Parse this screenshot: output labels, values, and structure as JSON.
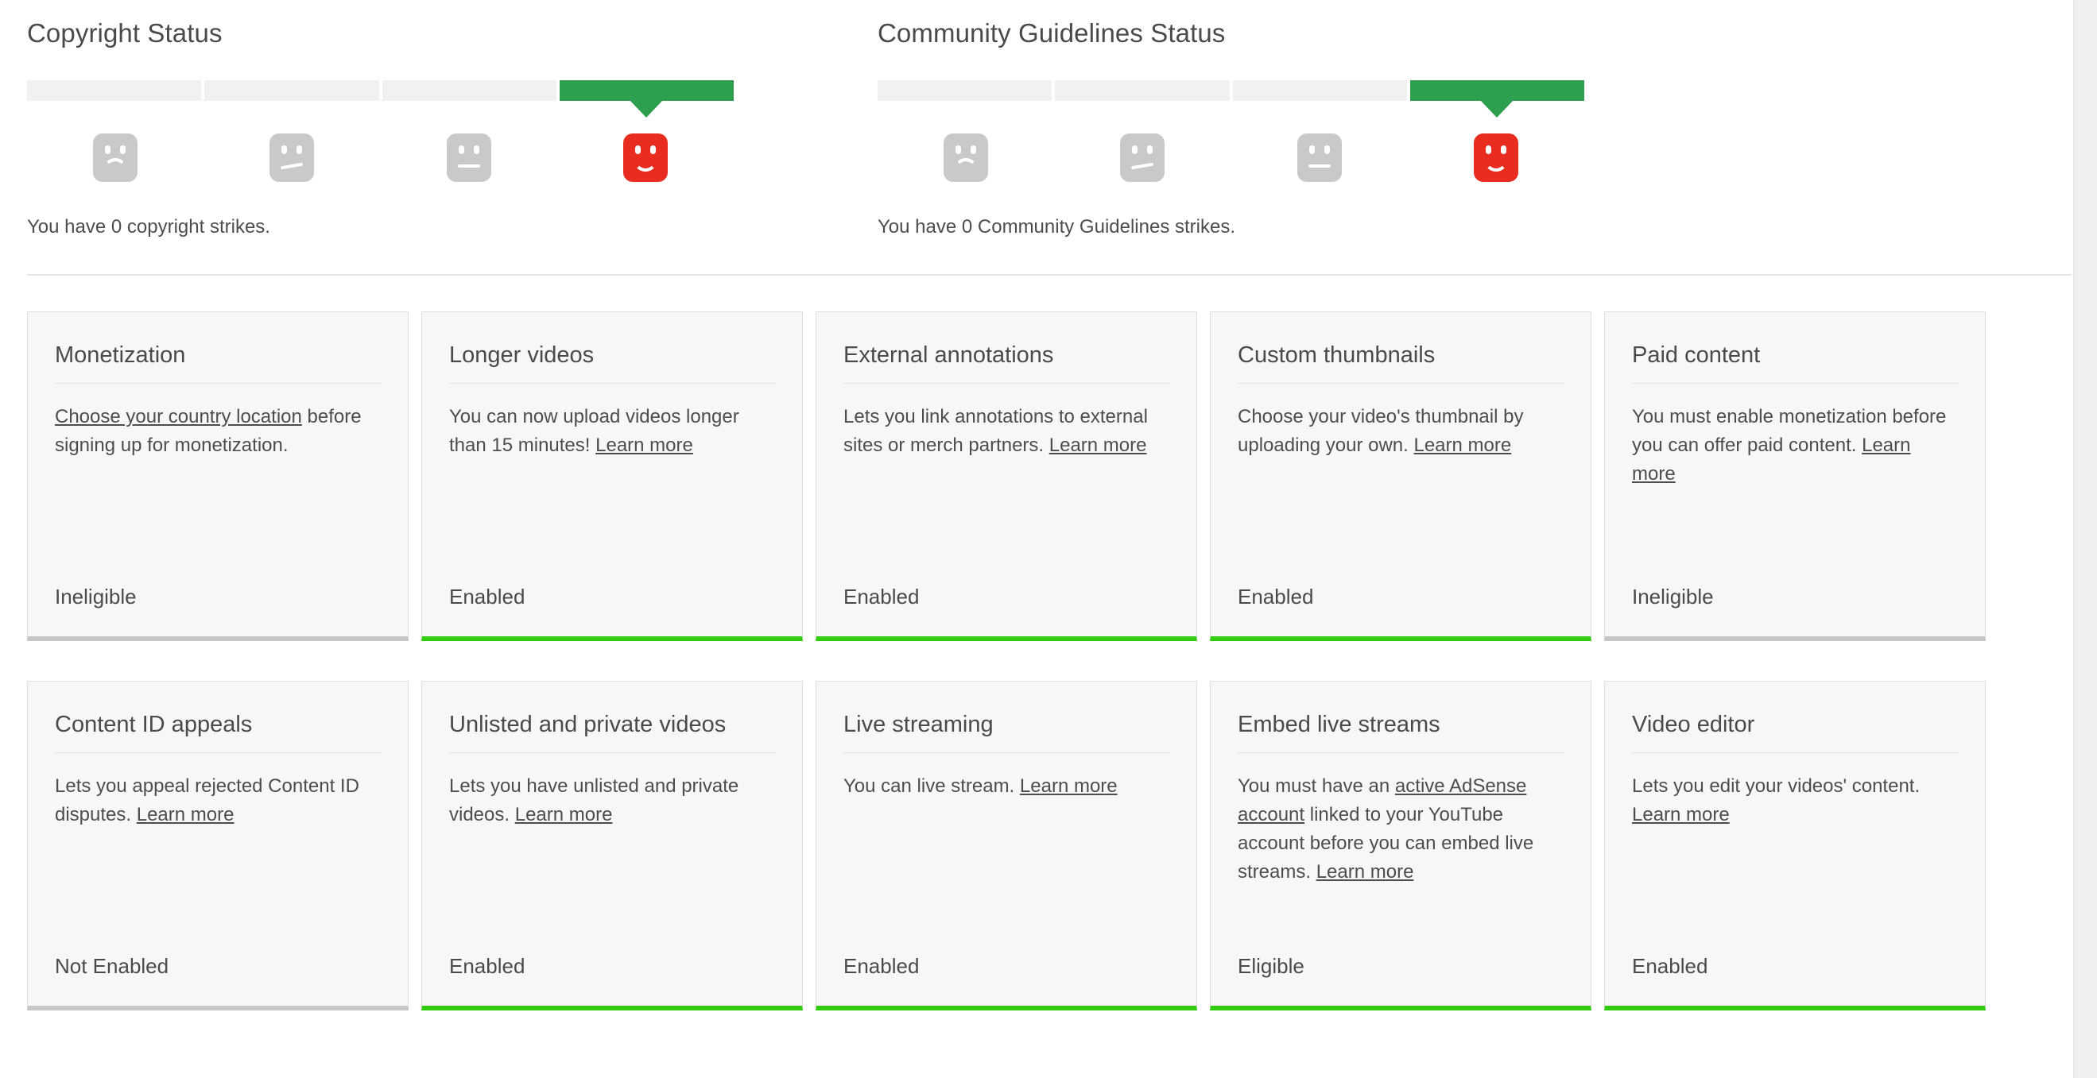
{
  "status_sections": [
    {
      "id": "copyright",
      "title": "Copyright Status",
      "caption": "You have 0 copyright strikes.",
      "segments": 4,
      "active_index": 3,
      "active_color": "#2e9e4f",
      "inactive_color": "#f1f1f1",
      "faces": [
        {
          "name": "sad-face-icon",
          "mood": "frown",
          "active": false
        },
        {
          "name": "slight-frown-icon",
          "mood": "slant",
          "active": false
        },
        {
          "name": "neutral-face-icon",
          "mood": "flat",
          "active": false
        },
        {
          "name": "happy-face-icon",
          "mood": "smile",
          "active": true
        }
      ]
    },
    {
      "id": "community",
      "title": "Community Guidelines Status",
      "caption": "You have 0 Community Guidelines strikes.",
      "segments": 4,
      "active_index": 3,
      "active_color": "#2e9e4f",
      "inactive_color": "#f1f1f1",
      "faces": [
        {
          "name": "sad-face-icon",
          "mood": "frown",
          "active": false
        },
        {
          "name": "slight-frown-icon",
          "mood": "slant",
          "active": false
        },
        {
          "name": "neutral-face-icon",
          "mood": "flat",
          "active": false
        },
        {
          "name": "happy-face-icon",
          "mood": "smile",
          "active": true
        }
      ]
    }
  ],
  "cards": [
    {
      "id": "monetization",
      "title": "Monetization",
      "body_parts": [
        {
          "text": "Choose your country location",
          "link": true
        },
        {
          "text": " before signing up for monetization.",
          "link": false
        }
      ],
      "status": "Ineligible",
      "enabled": false
    },
    {
      "id": "longer-videos",
      "title": "Longer videos",
      "body_parts": [
        {
          "text": "You can now upload videos longer than 15 minutes! ",
          "link": false
        },
        {
          "text": "Learn more",
          "link": true
        }
      ],
      "status": "Enabled",
      "enabled": true
    },
    {
      "id": "external-annotations",
      "title": "External annotations",
      "body_parts": [
        {
          "text": "Lets you link annotations to external sites or merch partners. ",
          "link": false
        },
        {
          "text": "Learn more",
          "link": true
        }
      ],
      "status": "Enabled",
      "enabled": true
    },
    {
      "id": "custom-thumbnails",
      "title": "Custom thumbnails",
      "body_parts": [
        {
          "text": "Choose your video's thumbnail by uploading your own. ",
          "link": false
        },
        {
          "text": "Learn more",
          "link": true
        }
      ],
      "status": "Enabled",
      "enabled": true
    },
    {
      "id": "paid-content",
      "title": "Paid content",
      "body_parts": [
        {
          "text": "You must enable monetization before you can offer paid content. ",
          "link": false
        },
        {
          "text": "Learn more",
          "link": true
        }
      ],
      "status": "Ineligible",
      "enabled": false
    },
    {
      "id": "content-id-appeals",
      "title": "Content ID appeals",
      "body_parts": [
        {
          "text": "Lets you appeal rejected Content ID disputes. ",
          "link": false
        },
        {
          "text": "Learn more",
          "link": true
        }
      ],
      "status": "Not Enabled",
      "enabled": false
    },
    {
      "id": "unlisted-and-private-videos",
      "title": "Unlisted and private videos",
      "body_parts": [
        {
          "text": "Lets you have unlisted and private videos. ",
          "link": false
        },
        {
          "text": "Learn more",
          "link": true
        }
      ],
      "status": "Enabled",
      "enabled": true
    },
    {
      "id": "live-streaming",
      "title": "Live streaming",
      "body_parts": [
        {
          "text": "You can live stream. ",
          "link": false
        },
        {
          "text": "Learn more",
          "link": true
        }
      ],
      "status": "Enabled",
      "enabled": true
    },
    {
      "id": "embed-live-streams",
      "title": "Embed live streams",
      "body_parts": [
        {
          "text": "You must have an ",
          "link": false
        },
        {
          "text": "active AdSense account",
          "link": true
        },
        {
          "text": " linked to your YouTube account before you can embed live streams. ",
          "link": false
        },
        {
          "text": "Learn more",
          "link": true
        }
      ],
      "status": "Eligible",
      "enabled": true
    },
    {
      "id": "video-editor",
      "title": "Video editor",
      "body_parts": [
        {
          "text": "Lets you edit your videos' content. ",
          "link": false
        },
        {
          "text": "Learn more",
          "link": true
        }
      ],
      "status": "Enabled",
      "enabled": true
    }
  ],
  "colors": {
    "enabled_border": "#33cc11",
    "disabled_border": "#c7c7c7",
    "bar_active": "#2e9e4f",
    "bar_inactive": "#f1f1f1",
    "face_inactive": "#c9c9c9",
    "face_active": "#e82c20",
    "card_bg": "#f7f7f7",
    "text": "#4d4d4d"
  }
}
